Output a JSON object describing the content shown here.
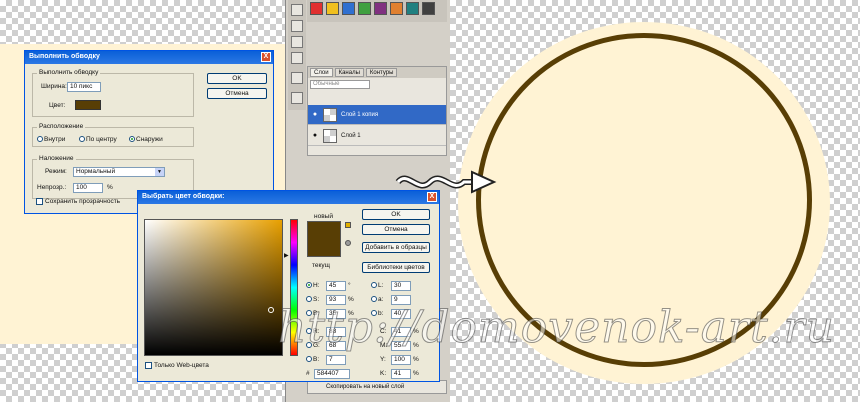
{
  "stroke_dialog": {
    "title": "Выполнить обводку",
    "stroke_group": "Выполнить обводку",
    "width_label": "Ширина:",
    "width_value": "10 пикс",
    "color_label": "Цвет:",
    "color_hex": "#583e05",
    "location_group": "Расположение",
    "loc_inside": "Внутри",
    "loc_center": "По центру",
    "loc_outside": "Снаружи",
    "blend_group": "Наложение",
    "mode_label": "Режим:",
    "mode_value": "Нормальный",
    "opacity_label": "Непрозр.:",
    "opacity_value": "100",
    "opacity_unit": "%",
    "preserve_label": "Сохранить прозрачность",
    "ok": "OK",
    "cancel": "Отмена",
    "close": "X"
  },
  "picker_dialog": {
    "title": "Выбрать цвет обводки:",
    "ok": "OK",
    "cancel": "Отмена",
    "add_swatches": "Добавить в образцы",
    "libraries": "Библиотеки цветов",
    "new_label": "новый",
    "current_label": "текущ",
    "web_only": "Только Web-цвета",
    "close": "X",
    "h_label": "H:",
    "h_value": "45",
    "h_unit": "°",
    "s_label": "S:",
    "s_value": "93",
    "s_unit": "%",
    "b_label": "B:",
    "b_value": "35",
    "b_unit": "%",
    "r_label": "R:",
    "r_value": "88",
    "g_label": "G:",
    "g_value": "68",
    "bl_label": "B:",
    "bl_value": "7",
    "l_label": "L:",
    "l_value": "30",
    "a_label": "a:",
    "a_value": "9",
    "bb_label": "b:",
    "bb_value": "40",
    "c_label": "C:",
    "c_value": "41",
    "c_unit": "%",
    "m_label": "M:",
    "m_value": "55",
    "m_unit": "%",
    "y_label": "Y:",
    "y_value": "100",
    "y_unit": "%",
    "k_label": "K:",
    "k_value": "41",
    "k_unit": "%",
    "hex_label": "#",
    "hex_value": "584407"
  },
  "layers_panel": {
    "tabs": [
      "Слои",
      "Каналы",
      "Контуры"
    ],
    "blend_mode": "Обычные",
    "layers": [
      "Слой 1 копия",
      "Слой 1"
    ],
    "history_item": "Скопировать на новый слой"
  },
  "watermark": "http://domovenok-art.ru",
  "colors": {
    "cream": "#fff3d4",
    "stroke_brown": "#583e05",
    "selection_blue": "#3169c6"
  }
}
